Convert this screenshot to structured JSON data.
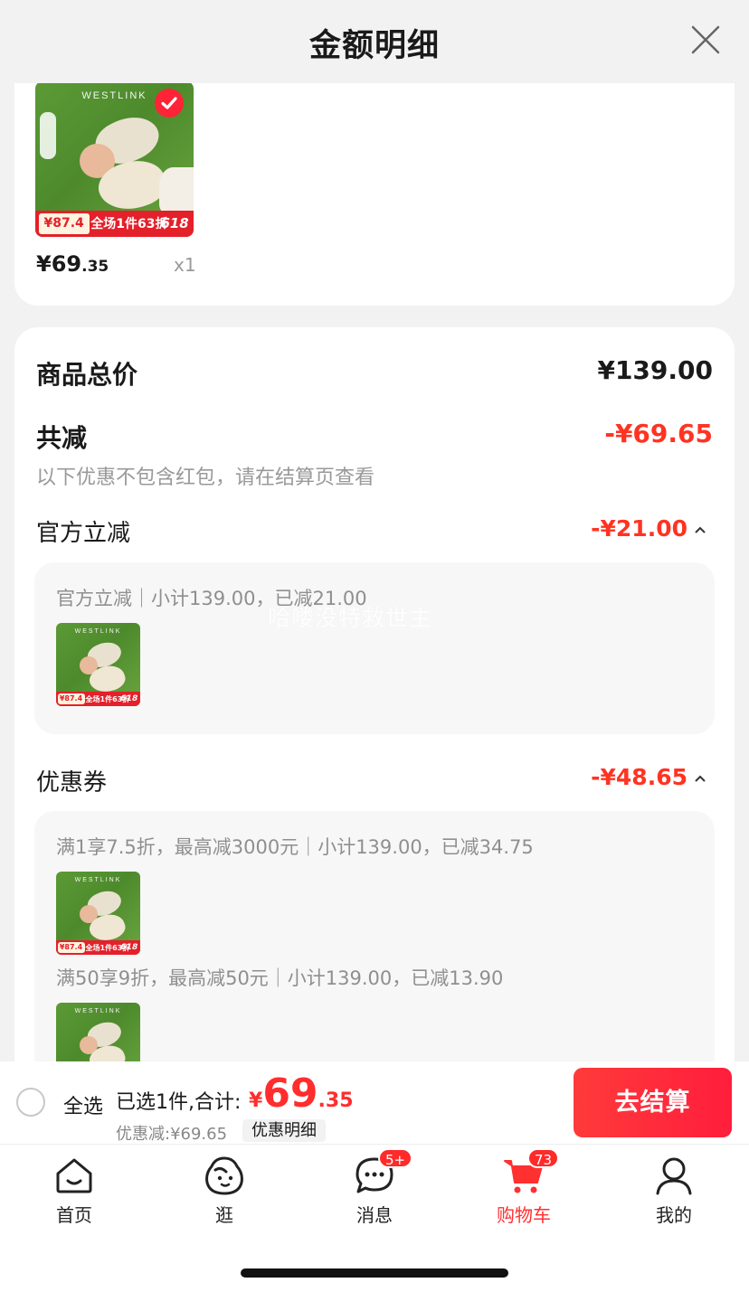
{
  "header": {
    "title": "金额明细"
  },
  "product": {
    "brand": "WESTLINK",
    "promo_price": "¥87.4",
    "promo_text": "全场1件63折",
    "tag": "618",
    "price_int": "¥69",
    "price_dec": ".35",
    "quantity": "x1"
  },
  "summary": {
    "total_label": "商品总价",
    "total_value": "¥139.00",
    "reduce_label": "共减",
    "reduce_value": "-¥69.65",
    "hint": "以下优惠不包含红包，请在结算页查看"
  },
  "official": {
    "label": "官方立减",
    "value": "-¥21.00",
    "detail": "官方立减｜小计139.00，已减21.00",
    "watermark": "哈喽没特救世主"
  },
  "coupon": {
    "label": "优惠券",
    "value": "-¥48.65",
    "line1": "满1享7.5折，最高减3000元｜小计139.00，已减34.75",
    "line2": "满50享9折，最高减50元｜小计139.00，已减13.90"
  },
  "bottom": {
    "select_all": "全选",
    "selected": "已选1件,合计:",
    "currency": "¥",
    "total_int": "69",
    "total_dec": ".35",
    "discount": "优惠减:¥69.65",
    "detail_chip": "优惠明细",
    "checkout": "去结算"
  },
  "tabs": [
    {
      "label": "首页",
      "icon": "home-icon"
    },
    {
      "label": "逛",
      "icon": "face-icon"
    },
    {
      "label": "消息",
      "icon": "message-icon",
      "badge": "5+"
    },
    {
      "label": "购物车",
      "icon": "cart-icon",
      "badge": "73",
      "active": true
    },
    {
      "label": "我的",
      "icon": "user-icon"
    }
  ],
  "colors": {
    "accent": "#ff3322",
    "checkout": "#ff2a3a",
    "background": "#f2f2f2"
  }
}
